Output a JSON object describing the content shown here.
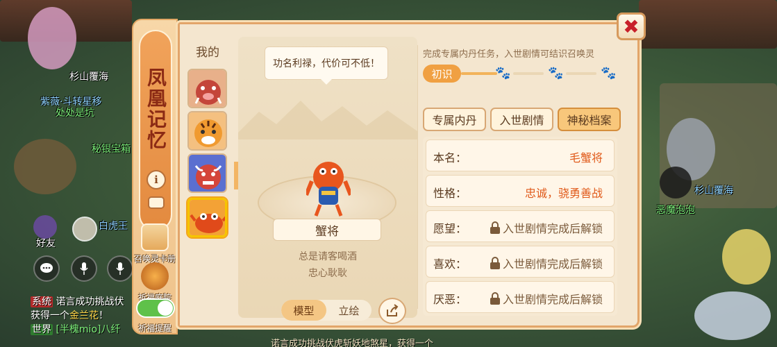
{
  "world": {
    "labels": [
      {
        "text": "杉山覆海",
        "cls": "c-white"
      },
      {
        "text": "紫薇·斗转星移",
        "cls": "c-blue"
      },
      {
        "text": "处处是坑",
        "cls": "c-green"
      },
      {
        "text": "秘银宝箱",
        "cls": "c-green"
      },
      {
        "text": "白虎王",
        "cls": "c-blue"
      },
      {
        "text": "好友",
        "cls": "c-white"
      },
      {
        "text": "杉山覆海",
        "cls": "c-blue"
      },
      {
        "text": "恶魔泡泡",
        "cls": "c-green"
      }
    ]
  },
  "chat": {
    "line1_tag": "系统",
    "line1_text": "诺言成功挑战伏",
    "line2_text": "获得一个",
    "line2_item": "金兰花",
    "line2_end": "！",
    "line3_tag": "世界",
    "line3_text": "[半槐mio]八纤",
    "bottom_text": "诺言成功挑战伏虎斩妖地煞星，获得一个"
  },
  "sidebar": {
    "title": "凤凰记忆",
    "info_label": "i",
    "card_book_label": "召唤灵卡册",
    "prayer_label": "祈福庭院",
    "prayer_remind_label": "祈福提醒"
  },
  "list": {
    "title": "我的",
    "pets": [
      {
        "name": "boar",
        "bg": "#e8a07a"
      },
      {
        "name": "tiger",
        "bg": "#f0b060"
      },
      {
        "name": "ox-demon",
        "bg": "#6a7fd0"
      },
      {
        "name": "crab-general",
        "bg": "#f3a236"
      }
    ]
  },
  "model": {
    "speech": "功名利禄，代价可不低！",
    "name": "蟹将",
    "desc1": "总是请客喝酒",
    "desc2": "忠心耿耿",
    "mode_model": "模型",
    "mode_art": "立绘"
  },
  "info": {
    "hint": "完成专属内丹任务，入世剧情可结识召唤灵",
    "stage": "初识",
    "tabs": [
      "专属内丹",
      "入世剧情",
      "神秘档案"
    ],
    "active_tab": 2,
    "rows": [
      {
        "label": "本名：",
        "value": "毛蟹将",
        "locked": false
      },
      {
        "label": "性格：",
        "value": "忠诚，骁勇善战",
        "locked": false
      },
      {
        "label": "愿望：",
        "value": "入世剧情完成后解锁",
        "locked": true
      },
      {
        "label": "喜欢：",
        "value": "入世剧情完成后解锁",
        "locked": true
      },
      {
        "label": "厌恶：",
        "value": "入世剧情完成后解锁",
        "locked": true
      }
    ]
  },
  "close_icon": "✖",
  "colors": {
    "accent": "#f0a042",
    "value": "#e05a1a"
  }
}
